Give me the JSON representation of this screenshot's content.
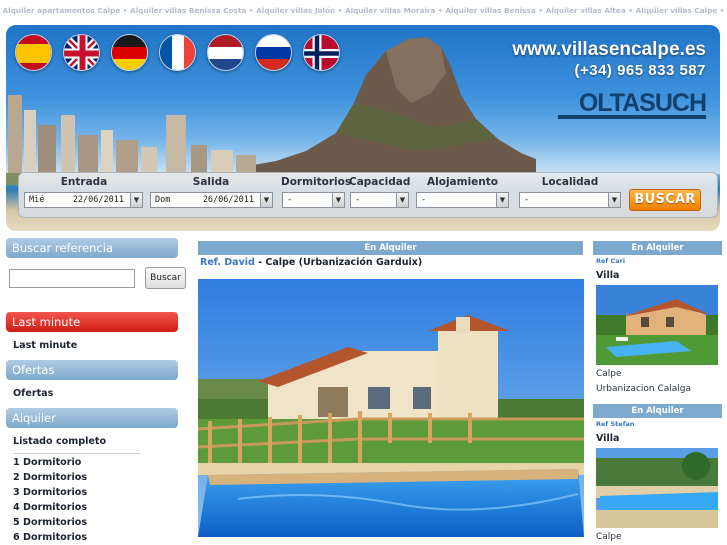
{
  "top_links": [
    "Alquiler apartamentos Calpe",
    "Alquiler villas Benissa Costa",
    "Alquiler villas Jalón",
    "Alquiler villas Moraira",
    "Alquiler villas Benissa",
    "Alquiler villas Altea",
    "Alquiler villas Calpe"
  ],
  "top_links_separator": "•",
  "header": {
    "url": "www.villasencalpe.es",
    "phone": "(+34) 965 833 587",
    "logo": "OLTASUCH",
    "flags": [
      "spanish-flag-icon",
      "british-flag-icon",
      "german-flag-icon",
      "french-flag-icon",
      "dutch-flag-icon",
      "russian-flag-icon",
      "norwegian-flag-icon"
    ]
  },
  "search": {
    "entrada_label": "Entrada",
    "entrada_day": "Mié",
    "entrada_date": "22/06/2011",
    "salida_label": "Salida",
    "salida_day": "Dom",
    "salida_date": "26/06/2011",
    "dormitorios_label": "Dormitorios",
    "dormitorios_value": "-",
    "capacidad_label": "Capacidad",
    "capacidad_value": "-",
    "alojamiento_label": "Alojamiento",
    "alojamiento_value": "-",
    "localidad_label": "Localidad",
    "localidad_value": "-",
    "buscar_label": "BUSCAR"
  },
  "sidebar": {
    "ref_title": "Buscar referencia",
    "ref_input_value": "",
    "ref_button": "Buscar",
    "last_minute_title": "Last minute",
    "last_minute_link": "Last minute",
    "ofertas_title": "Ofertas",
    "ofertas_link": "Ofertas",
    "alquiler_title": "Alquiler",
    "alquiler_links": [
      "Listado completo",
      "1 Dormitorio",
      "2 Dormitorios",
      "3 Dormitorios",
      "4 Dormitorios",
      "5 Dormitorios",
      "6 Dormitorios"
    ]
  },
  "main": {
    "heading": "En Alquiler",
    "ref": "Ref. David",
    "location": "Calpe (Urbanización Garduix)"
  },
  "right": {
    "items": [
      {
        "heading": "En Alquiler",
        "ref": "Ref Cari",
        "type": "Villa",
        "town": "Calpe",
        "area": "Urbanizacion Calalga"
      },
      {
        "heading": "En Alquiler",
        "ref": "Ref Stefan",
        "type": "Villa",
        "town": "Calpe",
        "area": ""
      }
    ]
  },
  "colors": {
    "accent_blue": "#7ea9cf",
    "sidebar_blue": "#aecbe4",
    "last_minute_red": "#cf1d14",
    "buscar_orange": "#f07d00",
    "ref_link": "#3a78c0"
  }
}
